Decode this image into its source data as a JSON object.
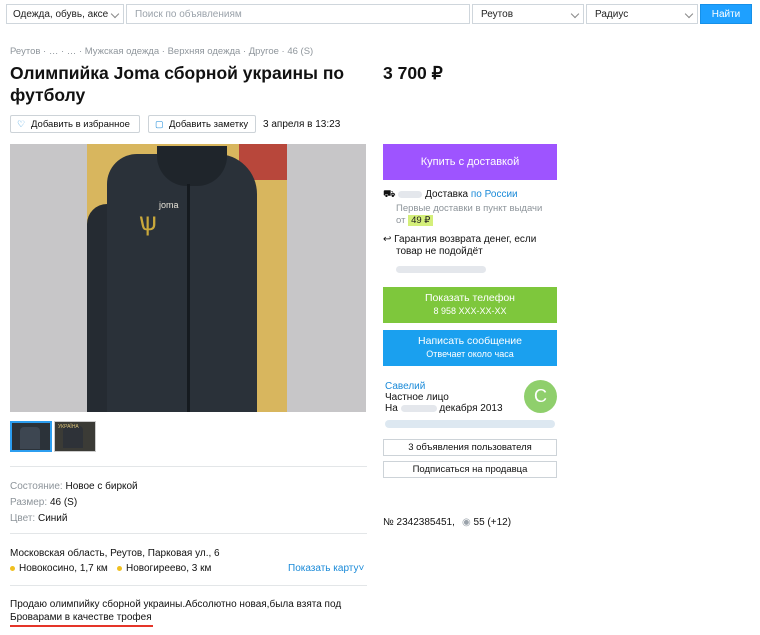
{
  "search": {
    "category": "Одежда, обувь, аксе",
    "query_placeholder": "Поиск по объявлениям",
    "city": "Реутов",
    "radius": "Радиус",
    "find_label": "Найти"
  },
  "breadcrumb": "Реутов · … · … · Мужская одежда · Верхняя одежда · Другое · 46 (S)",
  "listing": {
    "title": "Олимпийка Joma сборной украины по футболу",
    "price": "3 700 ₽",
    "fav_label": "Добавить в избранное",
    "note_label": "Добавить заметку",
    "date": "3 апреля в 13:23",
    "photo_logo": "joma",
    "thumb2_label": "УКРАЇНА"
  },
  "params": [
    {
      "key": "Состояние:",
      "value": "Новое с биркой"
    },
    {
      "key": "Размер:",
      "value": "46 (S)"
    },
    {
      "key": "Цвет:",
      "value": "Синий"
    }
  ],
  "location": {
    "address": "Московская область, Реутов, Парковая ул., 6",
    "metro": [
      {
        "name": "Новокосино,",
        "dist": "1,7 км"
      },
      {
        "name": "Новогиреево,",
        "dist": "3 км"
      }
    ],
    "show_map": "Показать карту"
  },
  "description": {
    "line1": "Продаю олимпийку сборной украины.Абсолютно новая,была взята под",
    "line2": "Броварами в качестве трофея"
  },
  "sidebar": {
    "buy_label": "Купить с доставкой",
    "delivery_label": "Доставка",
    "delivery_where": "по России",
    "delivery_note1": "Первые доставки в пункт выдачи",
    "delivery_from": "от",
    "delivery_price": "49 ₽",
    "guarantee1": "Гарантия возврата денег, если",
    "guarantee2": "товар не подойдёт",
    "phone_label": "Показать телефон",
    "phone_number": "8 958 XXX-XX-XX",
    "msg_label": "Написать сообщение",
    "msg_sub": "Отвечает около часа",
    "seller_name": "Савелий",
    "seller_type": "Частное лицо",
    "seller_since_prefix": "На",
    "seller_since_suffix": "декабря 2013",
    "avatar_letter": "С",
    "ads_button": "3 объявления пользователя",
    "subscribe_button": "Подписаться на продавца",
    "ad_number": "№ 2342385451,",
    "views": "55 (+12)"
  },
  "colors": {
    "buy": "#9e54ff",
    "phone": "#7ec73c",
    "message": "#1aa0ef",
    "link": "#1a8ad8",
    "underline": "#e53529"
  }
}
